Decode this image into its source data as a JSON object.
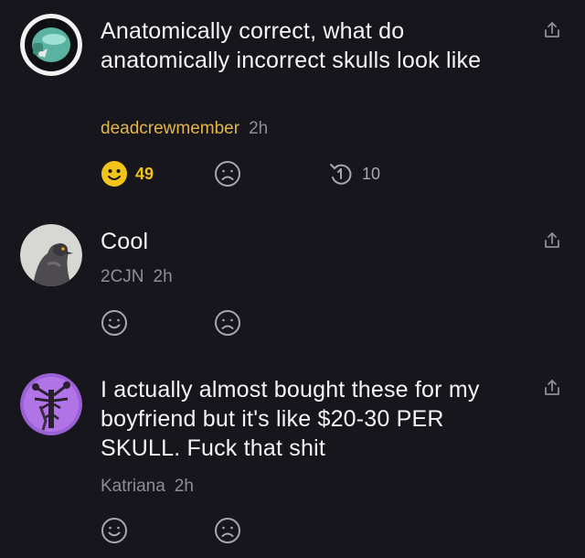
{
  "colors": {
    "background": "#17161c",
    "accent_yellow": "#f0c419",
    "op_name": "#e4b64b",
    "muted": "#8f8d96"
  },
  "comments": [
    {
      "avatar": "among-us-crewmate-avatar",
      "text": "Anatomically correct, what do anatomically incorrect skulls look like",
      "author": "deadcrewmember",
      "time": "2h",
      "like_count": "49",
      "reply_count": "10"
    },
    {
      "avatar": "pigeon-avatar",
      "text": "Cool",
      "author": "2CJN",
      "time": "2h"
    },
    {
      "avatar": "siren-head-avatar",
      "text": "I actually almost bought these for my boyfriend but it's like $20-30 PER SKULL. Fuck that shit",
      "author": "Katriana",
      "time": "2h"
    }
  ],
  "icons": {
    "share": "share-icon",
    "like": "smile-icon",
    "dislike": "frown-icon",
    "reply": "reply-icon"
  }
}
